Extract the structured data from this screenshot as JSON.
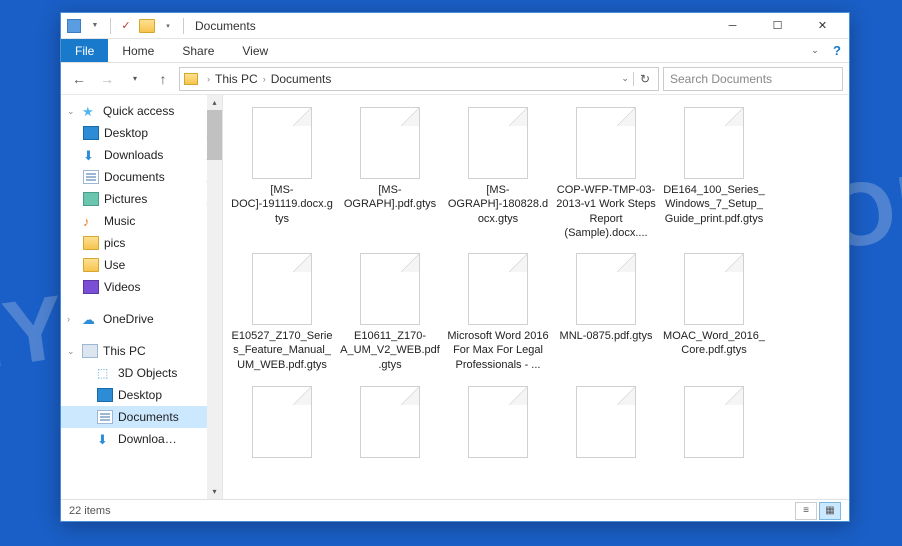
{
  "watermark": "MYANTISPYWARE.COM",
  "window": {
    "title": "Documents"
  },
  "ribbon": {
    "tabs": [
      "File",
      "Home",
      "Share",
      "View"
    ]
  },
  "breadcrumb": {
    "root": "This PC",
    "leaf": "Documents"
  },
  "search": {
    "placeholder": "Search Documents"
  },
  "navpane": {
    "quick_access": "Quick access",
    "qa_items": [
      {
        "label": "Desktop",
        "icon": "desktop",
        "pinned": true
      },
      {
        "label": "Downloads",
        "icon": "downloads",
        "pinned": true
      },
      {
        "label": "Documents",
        "icon": "doc",
        "pinned": true
      },
      {
        "label": "Pictures",
        "icon": "pic",
        "pinned": true
      },
      {
        "label": "Music",
        "icon": "music",
        "pinned": false
      },
      {
        "label": "pics",
        "icon": "folder",
        "pinned": false
      },
      {
        "label": "Use",
        "icon": "folder",
        "pinned": false
      },
      {
        "label": "Videos",
        "icon": "video",
        "pinned": false
      }
    ],
    "onedrive": "OneDrive",
    "this_pc": "This PC",
    "pc_items": [
      {
        "label": "3D Objects",
        "icon": "3d"
      },
      {
        "label": "Desktop",
        "icon": "desktop"
      },
      {
        "label": "Documents",
        "icon": "doc",
        "selected": true
      },
      {
        "label": "Downloads",
        "icon": "downloads",
        "cut": true
      }
    ]
  },
  "files": [
    {
      "name": "[MS-DOC]-191119.docx.gtys"
    },
    {
      "name": "[MS-OGRAPH].pdf.gtys"
    },
    {
      "name": "[MS-OGRAPH]-180828.docx.gtys"
    },
    {
      "name": "COP-WFP-TMP-03-2013-v1 Work Steps Report (Sample).docx...."
    },
    {
      "name": "DE164_100_Series_Windows_7_Setup_Guide_print.pdf.gtys"
    },
    {
      "name": "E10527_Z170_Series_Feature_Manual_UM_WEB.pdf.gtys"
    },
    {
      "name": "E10611_Z170-A_UM_V2_WEB.pdf.gtys"
    },
    {
      "name": "Microsoft Word 2016 For Max For Legal Professionals - ..."
    },
    {
      "name": "MNL-0875.pdf.gtys"
    },
    {
      "name": "MOAC_Word_2016_Core.pdf.gtys"
    },
    {
      "name": ""
    },
    {
      "name": ""
    },
    {
      "name": ""
    },
    {
      "name": ""
    },
    {
      "name": ""
    }
  ],
  "statusbar": {
    "count": "22 items"
  }
}
